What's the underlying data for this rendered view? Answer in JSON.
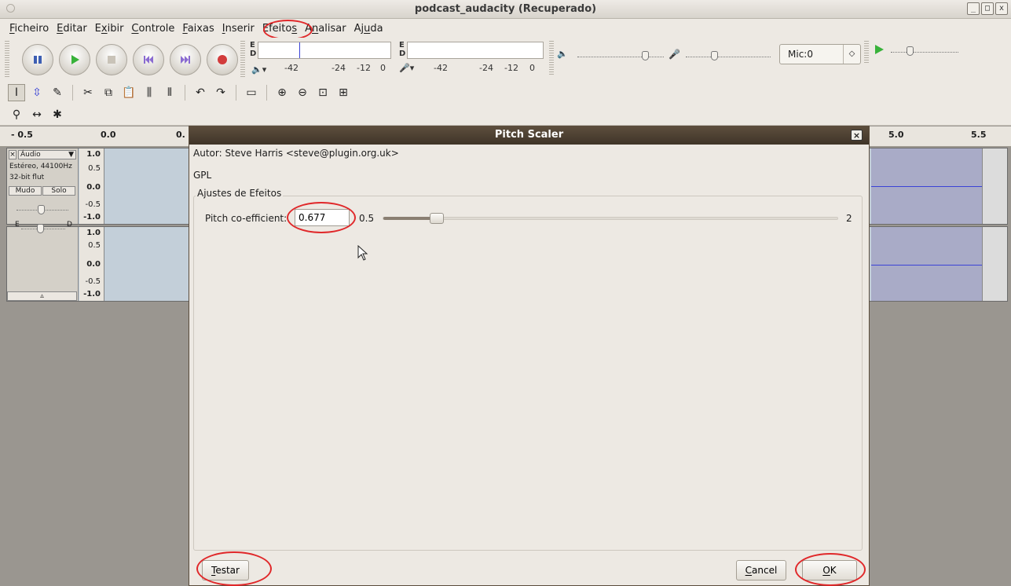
{
  "window": {
    "title": "podcast_audacity (Recuperado)",
    "controls": [
      "_",
      "□",
      "x"
    ]
  },
  "menu": [
    {
      "pre": "",
      "u": "F",
      "post": "icheiro"
    },
    {
      "pre": "",
      "u": "E",
      "post": "ditar"
    },
    {
      "pre": "E",
      "u": "x",
      "post": "ibir"
    },
    {
      "pre": "",
      "u": "C",
      "post": "ontrole"
    },
    {
      "pre": "",
      "u": "F",
      "post": "aixas"
    },
    {
      "pre": "",
      "u": "I",
      "post": "nserir"
    },
    {
      "pre": "Efeito",
      "u": "s",
      "post": ""
    },
    {
      "pre": "A",
      "u": "n",
      "post": "alisar"
    },
    {
      "pre": "Aj",
      "u": "u",
      "post": "da"
    }
  ],
  "meters": {
    "channel_e": "E",
    "channel_d": "D",
    "scale_42": "-42",
    "scale_24": "-24",
    "scale_12": "-12",
    "scale_0": "0"
  },
  "mixer": {
    "mic_device": "Mic:0"
  },
  "ruler": {
    "ticks": [
      "- 0.5",
      "0.0",
      "0.",
      "5.0",
      "5.5"
    ]
  },
  "track": {
    "name": "Áudio",
    "rate": "Estéreo, 44100Hz",
    "format": "32-bit flut",
    "mute": "Mudo",
    "solo": "Solo",
    "pan_left": "E",
    "pan_right": "D",
    "scale": [
      "1.0",
      "0.5",
      "0.0",
      "-0.5",
      "-1.0"
    ]
  },
  "dialog": {
    "title": "Pitch Scaler",
    "author": "Autor: Steve Harris <steve@plugin.org.uk>",
    "license": "GPL",
    "group": "Ajustes de Efeitos",
    "param_label": "Pitch co-efficient:",
    "param_value": "0.677",
    "min": "0.5",
    "max": "2",
    "slider_fraction": 0.118,
    "test_button": {
      "u": "T",
      "rest": "estar"
    },
    "cancel_button": {
      "u": "C",
      "rest": "ancel"
    },
    "ok_button": {
      "u": "O",
      "rest": "K"
    }
  }
}
